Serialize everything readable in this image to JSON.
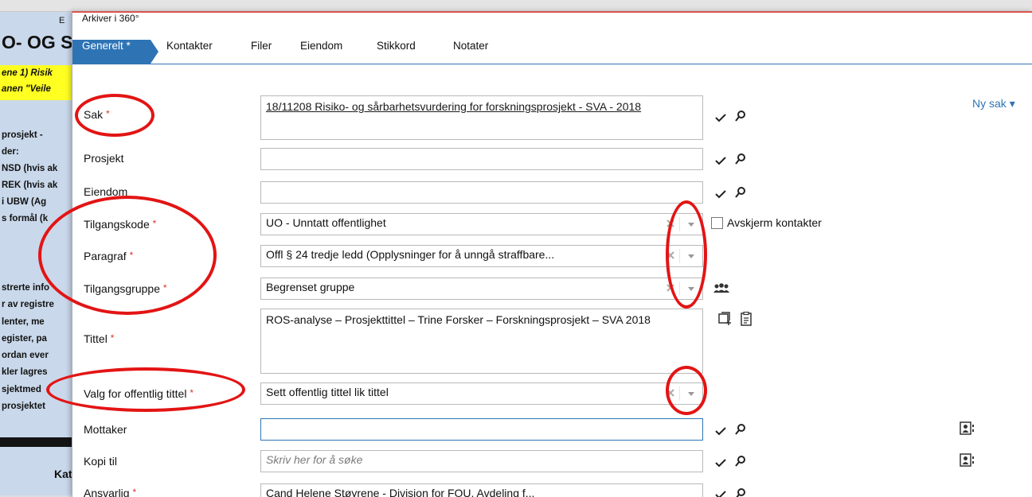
{
  "background_doc": {
    "top_letter": "E",
    "title": "O- OG S",
    "yellow_lines": [
      "ene 1) Risik",
      "anen \"Veile"
    ],
    "lines": [
      "prosjekt - ",
      "der:",
      "NSD (hvis ak",
      "REK (hvis ak",
      "i UBW (Ag",
      "s formål (k"
    ],
    "lines2": [
      "strerte info",
      "r av registre",
      "lenter, me",
      "egister, pa",
      "ordan ever",
      "kler lagres",
      "sjektmed",
      "prosjektet"
    ],
    "kateg": "Kateg"
  },
  "window": {
    "title": "Arkiver i 360°"
  },
  "tabs": [
    {
      "label": "Generelt *"
    },
    {
      "label": "Kontakter"
    },
    {
      "label": "Filer"
    },
    {
      "label": "Eiendom"
    },
    {
      "label": "Stikkord"
    },
    {
      "label": "Notater"
    }
  ],
  "new_case": "Ny sak",
  "fields": {
    "sak": {
      "label": "Sak",
      "value": "18/11208 Risiko- og sårbarhetsvurdering for forskningsprosjekt - SVA - 2018"
    },
    "prosjekt": {
      "label": "Prosjekt",
      "value": ""
    },
    "eiendom": {
      "label": "Eiendom",
      "value": ""
    },
    "tilgangskode": {
      "label": "Tilgangskode",
      "value": "UO - Unntatt offentlighet"
    },
    "paragraf": {
      "label": "Paragraf",
      "value": "Offl § 24 tredje ledd (Opplysninger for å unngå straffbare..."
    },
    "tilgangsgruppe": {
      "label": "Tilgangsgruppe",
      "value": "Begrenset gruppe"
    },
    "tittel": {
      "label": "Tittel",
      "value": "ROS-analyse – Prosjekttittel – Trine Forsker – Forskningsprosjekt – SVA 2018"
    },
    "offentlig_tittel": {
      "label": "Valg for offentlig tittel",
      "value": "Sett offentlig tittel lik tittel"
    },
    "mottaker": {
      "label": "Mottaker",
      "value": ""
    },
    "kopi_til": {
      "label": "Kopi til",
      "placeholder": "Skriv her for å søke"
    },
    "ansvarlig": {
      "label": "Ansvarlig",
      "value": "Cand Helene Støyrene - Division for FOU, Avdeling f..."
    }
  },
  "required_mark": "*",
  "shield_contacts": "Avskjerm kontakter",
  "colors": {
    "accent": "#2e74b5",
    "required": "#d9342b",
    "annotation": "#e31414"
  },
  "icons": [
    "check-icon",
    "search-icon",
    "group-icon",
    "add-document-icon",
    "clipboard-icon",
    "contact-card-icon",
    "clear-icon",
    "dropdown-arrow-icon"
  ]
}
